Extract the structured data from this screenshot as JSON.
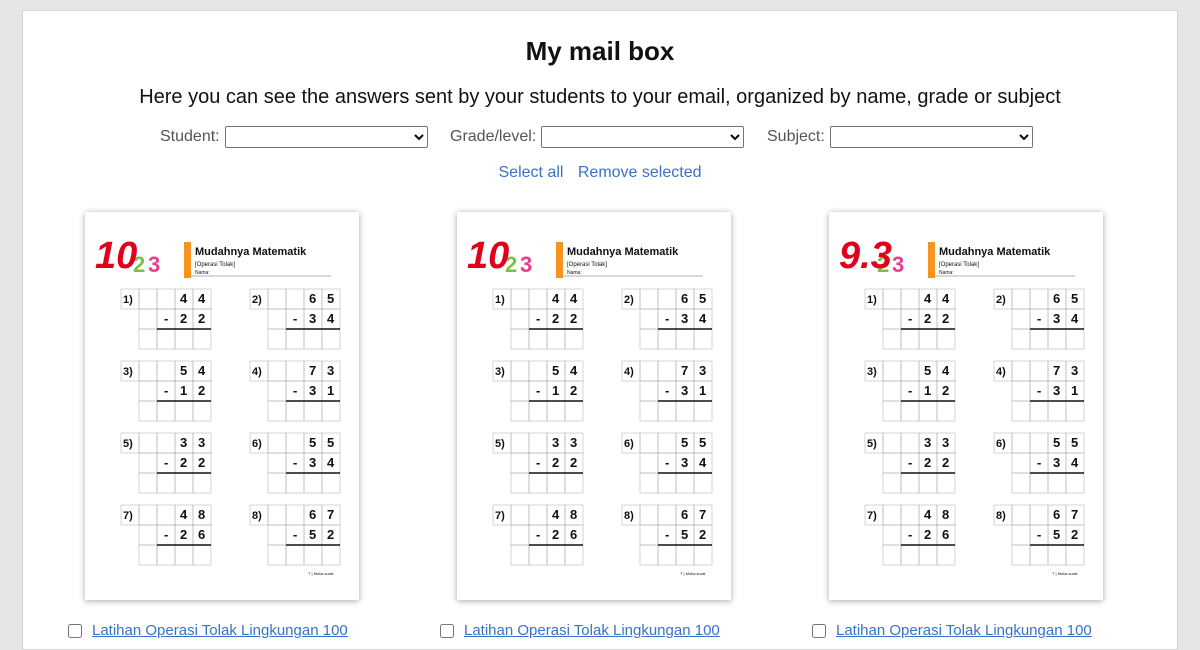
{
  "header": {
    "title": "My mail box",
    "subtitle": "Here you can see the answers sent by your students to your email, organized by name, grade or subject"
  },
  "filters": {
    "student_label": "Student:",
    "grade_label": "Grade/level:",
    "subject_label": "Subject:",
    "student_value": "",
    "grade_value": "",
    "subject_value": ""
  },
  "actions": {
    "select_all": "Select all",
    "remove_selected": "Remove selected"
  },
  "worksheet": {
    "heading": "Mudahnya Matematik",
    "subheading": "[Operasi Tolak]",
    "name_label": "Nama:",
    "footer": "T | Muka surat",
    "problems": [
      {
        "num": "1)",
        "a": "4 4",
        "b": "2 2"
      },
      {
        "num": "2)",
        "a": "6 5",
        "b": "3 4"
      },
      {
        "num": "3)",
        "a": "5 4",
        "b": "1 2"
      },
      {
        "num": "4)",
        "a": "7 3",
        "b": "3 1"
      },
      {
        "num": "5)",
        "a": "3 3",
        "b": "2 2"
      },
      {
        "num": "6)",
        "a": "5 5",
        "b": "3 4"
      },
      {
        "num": "7)",
        "a": "4 8",
        "b": "2 6"
      },
      {
        "num": "8)",
        "a": "6 7",
        "b": "5 2"
      }
    ]
  },
  "submissions": [
    {
      "score": "10",
      "caption": "Latihan Operasi Tolak Lingkungan 100"
    },
    {
      "score": "10",
      "caption": "Latihan Operasi Tolak Lingkungan 100"
    },
    {
      "score": "9.3",
      "caption": "Latihan Operasi Tolak Lingkungan 100"
    }
  ],
  "colors": {
    "link": "#3872c9",
    "score": "#e0001b",
    "logo_green": "#7cc142",
    "logo_pink": "#e83e8c",
    "logo_orange": "#f7941d"
  }
}
